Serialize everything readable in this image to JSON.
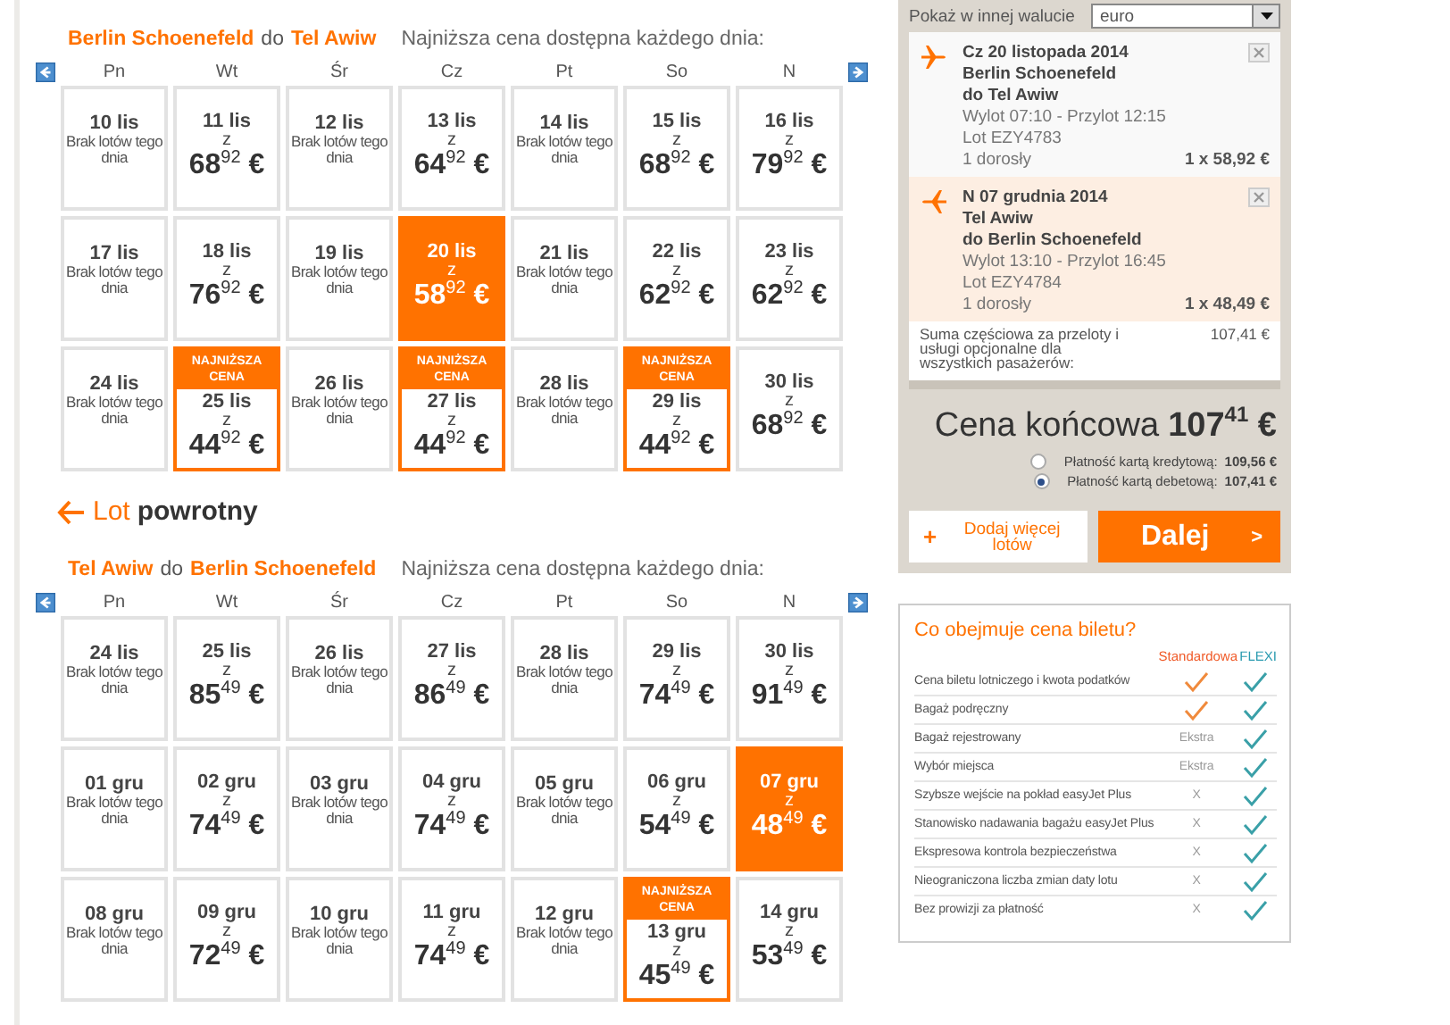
{
  "outbound": {
    "from": "Berlin Schoenefeld",
    "joiner": "do",
    "to": "Tel Awiw",
    "hint": "Najniższa cena dostępna każdego dnia:",
    "days": [
      "Pn",
      "Wt",
      "Śr",
      "Cz",
      "Pt",
      "So",
      "N"
    ],
    "cells": [
      {
        "date": "10 lis",
        "kind": "none",
        "note": "Brak lotów tego dnia",
        "selected": false
      },
      {
        "date": "11 lis",
        "kind": "price",
        "from": "z",
        "amount": "68",
        "cents": "92",
        "currency": "€",
        "selected": false
      },
      {
        "date": "12 lis",
        "kind": "none",
        "note": "Brak lotów tego dnia",
        "selected": false
      },
      {
        "date": "13 lis",
        "kind": "price",
        "from": "z",
        "amount": "64",
        "cents": "92",
        "currency": "€",
        "selected": false
      },
      {
        "date": "14 lis",
        "kind": "none",
        "note": "Brak lotów tego dnia",
        "selected": false
      },
      {
        "date": "15 lis",
        "kind": "price",
        "from": "z",
        "amount": "68",
        "cents": "92",
        "currency": "€",
        "selected": false
      },
      {
        "date": "16 lis",
        "kind": "price",
        "from": "z",
        "amount": "79",
        "cents": "92",
        "currency": "€",
        "selected": false
      },
      {
        "date": "17 lis",
        "kind": "none",
        "note": "Brak lotów tego dnia",
        "selected": false
      },
      {
        "date": "18 lis",
        "kind": "price",
        "from": "z",
        "amount": "76",
        "cents": "92",
        "currency": "€",
        "selected": false
      },
      {
        "date": "19 lis",
        "kind": "none",
        "note": "Brak lotów tego dnia",
        "selected": false
      },
      {
        "date": "20 lis",
        "kind": "price",
        "from": "z",
        "amount": "58",
        "cents": "92",
        "currency": "€",
        "selected": true
      },
      {
        "date": "21 lis",
        "kind": "none",
        "note": "Brak lotów tego dnia",
        "selected": false
      },
      {
        "date": "22 lis",
        "kind": "price",
        "from": "z",
        "amount": "62",
        "cents": "92",
        "currency": "€",
        "selected": false
      },
      {
        "date": "23 lis",
        "kind": "price",
        "from": "z",
        "amount": "62",
        "cents": "92",
        "currency": "€",
        "selected": false
      },
      {
        "date": "24 lis",
        "kind": "none",
        "note": "Brak lotów tego dnia",
        "selected": false
      },
      {
        "date": "25 lis",
        "kind": "price",
        "badge": "NAJNIŻSZA CENA",
        "from": "z",
        "amount": "44",
        "cents": "92",
        "currency": "€",
        "selected": false
      },
      {
        "date": "26 lis",
        "kind": "none",
        "note": "Brak lotów tego dnia",
        "selected": false
      },
      {
        "date": "27 lis",
        "kind": "price",
        "badge": "NAJNIŻSZA CENA",
        "from": "z",
        "amount": "44",
        "cents": "92",
        "currency": "€",
        "selected": false
      },
      {
        "date": "28 lis",
        "kind": "none",
        "note": "Brak lotów tego dnia",
        "selected": false
      },
      {
        "date": "29 lis",
        "kind": "price",
        "badge": "NAJNIŻSZA CENA",
        "from": "z",
        "amount": "44",
        "cents": "92",
        "currency": "€",
        "selected": false
      },
      {
        "date": "30 lis",
        "kind": "price",
        "from": "z",
        "amount": "68",
        "cents": "92",
        "currency": "€",
        "selected": false
      }
    ]
  },
  "return_heading": {
    "first": "Lot",
    "second": "powrotny"
  },
  "inbound": {
    "from": "Tel Awiw",
    "joiner": "do",
    "to": "Berlin Schoenefeld",
    "hint": "Najniższa cena dostępna każdego dnia:",
    "days": [
      "Pn",
      "Wt",
      "Śr",
      "Cz",
      "Pt",
      "So",
      "N"
    ],
    "cells": [
      {
        "date": "24 lis",
        "kind": "none",
        "note": "Brak lotów tego dnia",
        "selected": false
      },
      {
        "date": "25 lis",
        "kind": "price",
        "from": "z",
        "amount": "85",
        "cents": "49",
        "currency": "€",
        "selected": false
      },
      {
        "date": "26 lis",
        "kind": "none",
        "note": "Brak lotów tego dnia",
        "selected": false
      },
      {
        "date": "27 lis",
        "kind": "price",
        "from": "z",
        "amount": "86",
        "cents": "49",
        "currency": "€",
        "selected": false
      },
      {
        "date": "28 lis",
        "kind": "none",
        "note": "Brak lotów tego dnia",
        "selected": false
      },
      {
        "date": "29 lis",
        "kind": "price",
        "from": "z",
        "amount": "74",
        "cents": "49",
        "currency": "€",
        "selected": false
      },
      {
        "date": "30 lis",
        "kind": "price",
        "from": "z",
        "amount": "91",
        "cents": "49",
        "currency": "€",
        "selected": false
      },
      {
        "date": "01 gru",
        "kind": "none",
        "note": "Brak lotów tego dnia",
        "selected": false
      },
      {
        "date": "02 gru",
        "kind": "price",
        "from": "z",
        "amount": "74",
        "cents": "49",
        "currency": "€",
        "selected": false
      },
      {
        "date": "03 gru",
        "kind": "none",
        "note": "Brak lotów tego dnia",
        "selected": false
      },
      {
        "date": "04 gru",
        "kind": "price",
        "from": "z",
        "amount": "74",
        "cents": "49",
        "currency": "€",
        "selected": false
      },
      {
        "date": "05 gru",
        "kind": "none",
        "note": "Brak lotów tego dnia",
        "selected": false
      },
      {
        "date": "06 gru",
        "kind": "price",
        "from": "z",
        "amount": "54",
        "cents": "49",
        "currency": "€",
        "selected": false
      },
      {
        "date": "07 gru",
        "kind": "price",
        "from": "z",
        "amount": "48",
        "cents": "49",
        "currency": "€",
        "selected": true
      },
      {
        "date": "08 gru",
        "kind": "none",
        "note": "Brak lotów tego dnia",
        "selected": false
      },
      {
        "date": "09 gru",
        "kind": "price",
        "from": "z",
        "amount": "72",
        "cents": "49",
        "currency": "€",
        "selected": false
      },
      {
        "date": "10 gru",
        "kind": "none",
        "note": "Brak lotów tego dnia",
        "selected": false
      },
      {
        "date": "11 gru",
        "kind": "price",
        "from": "z",
        "amount": "74",
        "cents": "49",
        "currency": "€",
        "selected": false
      },
      {
        "date": "12 gru",
        "kind": "none",
        "note": "Brak lotów tego dnia",
        "selected": false
      },
      {
        "date": "13 gru",
        "kind": "price",
        "badge": "NAJNIŻSZA CENA",
        "from": "z",
        "amount": "45",
        "cents": "49",
        "currency": "€",
        "selected": false
      },
      {
        "date": "14 gru",
        "kind": "price",
        "from": "z",
        "amount": "53",
        "cents": "49",
        "currency": "€",
        "selected": false
      }
    ]
  },
  "basket": {
    "currency_label": "Pokaż w innej walucie",
    "currency_value": "euro",
    "flights": [
      {
        "kind": "outbound",
        "highlighted": false,
        "date": "Cz 20 listopada 2014",
        "from": "Berlin Schoenefeld",
        "to": "do Tel Awiw",
        "times": "Wylot 07:10 - Przylot 12:15",
        "flight": "Lot EZY4783",
        "passengers": "1 dorosły",
        "price": "1 x 58,92 €"
      },
      {
        "kind": "return",
        "highlighted": true,
        "date": "N 07 grudnia 2014",
        "from": "Tel Awiw",
        "to": "do Berlin Schoenefeld",
        "times": "Wylot 13:10 - Przylot 16:45",
        "flight": "Lot EZY4784",
        "passengers": "1 dorosły",
        "price": "1 x 48,49 €"
      }
    ],
    "subtotal_label": "Suma częściowa za przeloty i usługi opcjonalne dla wszystkich pasażerów:",
    "subtotal": "107,41 €",
    "total_label": "Cena końcowa",
    "total_amount": "107",
    "total_cents": "41",
    "total_currency": "€",
    "payments": [
      {
        "label": "Płatność kartą kredytową:",
        "amount": "109,56 €",
        "selected": false
      },
      {
        "label": "Płatność kartą debetową:",
        "amount": "107,41 €",
        "selected": true
      }
    ],
    "add_button": {
      "icon": "+",
      "label": "Dodaj więcej lotów"
    },
    "next_button": {
      "label": "Dalej",
      "icon": ">"
    }
  },
  "comparison": {
    "title": "Co obejmuje cena biletu?",
    "columns": [
      "Standardowa",
      "FLEXI"
    ],
    "rows": [
      {
        "label": "Cena biletu lotniczego i kwota podatków",
        "standard": {
          "kind": "check"
        },
        "flexi": {
          "kind": "check"
        }
      },
      {
        "label": "Bagaż podręczny",
        "standard": {
          "kind": "check"
        },
        "flexi": {
          "kind": "check"
        }
      },
      {
        "label": "Bagaż rejestrowany",
        "standard": {
          "kind": "text",
          "text": "Ekstra"
        },
        "flexi": {
          "kind": "check"
        }
      },
      {
        "label": "Wybór miejsca",
        "standard": {
          "kind": "text",
          "text": "Ekstra"
        },
        "flexi": {
          "kind": "check"
        }
      },
      {
        "label": "Szybsze wejście na pokład easyJet Plus",
        "standard": {
          "kind": "text",
          "text": "X"
        },
        "flexi": {
          "kind": "check"
        }
      },
      {
        "label": "Stanowisko nadawania bagażu easyJet Plus",
        "standard": {
          "kind": "text",
          "text": "X"
        },
        "flexi": {
          "kind": "check"
        }
      },
      {
        "label": "Ekspresowa kontrola bezpieczeństwa",
        "standard": {
          "kind": "text",
          "text": "X"
        },
        "flexi": {
          "kind": "check"
        }
      },
      {
        "label": "Nieograniczona liczba zmian daty lotu",
        "standard": {
          "kind": "text",
          "text": "X"
        },
        "flexi": {
          "kind": "check"
        }
      },
      {
        "label": "Bez prowizji za płatność",
        "standard": {
          "kind": "text",
          "text": "X"
        },
        "flexi": {
          "kind": "check"
        }
      }
    ]
  }
}
